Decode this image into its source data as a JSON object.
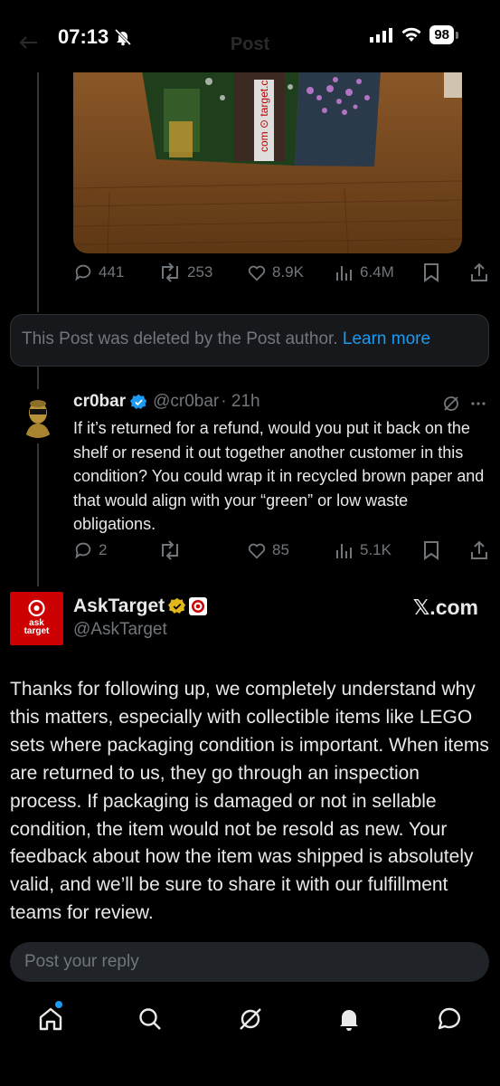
{
  "status_bar": {
    "time": "07:13",
    "battery": "98"
  },
  "nav": {
    "title": "Post"
  },
  "quoted_post": {
    "stats": {
      "replies": "441",
      "reposts": "253",
      "likes": "8.9K",
      "views": "6.4M"
    }
  },
  "deleted_notice": {
    "text": "This Post was deleted by the Post author.",
    "link": "Learn more"
  },
  "reply": {
    "name": "cr0bar",
    "handle": "@cr0bar",
    "time": "· 21h",
    "body": "If it’s returned for a refund, would you put it back on the shelf or resend it out together another customer in this condition? You could wrap it in recycled brown paper and that would align with your “green” or low waste obligations.",
    "stats": {
      "replies": "2",
      "reposts": "",
      "likes": "85",
      "views": "5.1K"
    }
  },
  "main_post": {
    "name": "AskTarget",
    "handle": "@AskTarget",
    "avatar_text_top": "ask",
    "avatar_text_bottom": "target",
    "source": "𝕏.com",
    "body": "Thanks for following up, we completely understand why this matters, especially with collectible items like LEGO sets where packaging condition is important. When items are returned to us, they go through an inspection process. If packaging is damaged or not in sellable condition, the item would not be resold as new. Your feedback about how the item was shipped is absolutely valid, and we’ll be sure to share it with our fulfillment teams for review."
  },
  "reply_input": {
    "placeholder": "Post your reply"
  },
  "tabbar": {
    "items": [
      "home-icon",
      "search-icon",
      "grok-icon",
      "notifications-icon",
      "messages-icon"
    ]
  },
  "colors": {
    "accent": "#1d9bf0",
    "muted": "#71767b",
    "target_red": "#cc0000",
    "gold": "#e2b719"
  }
}
